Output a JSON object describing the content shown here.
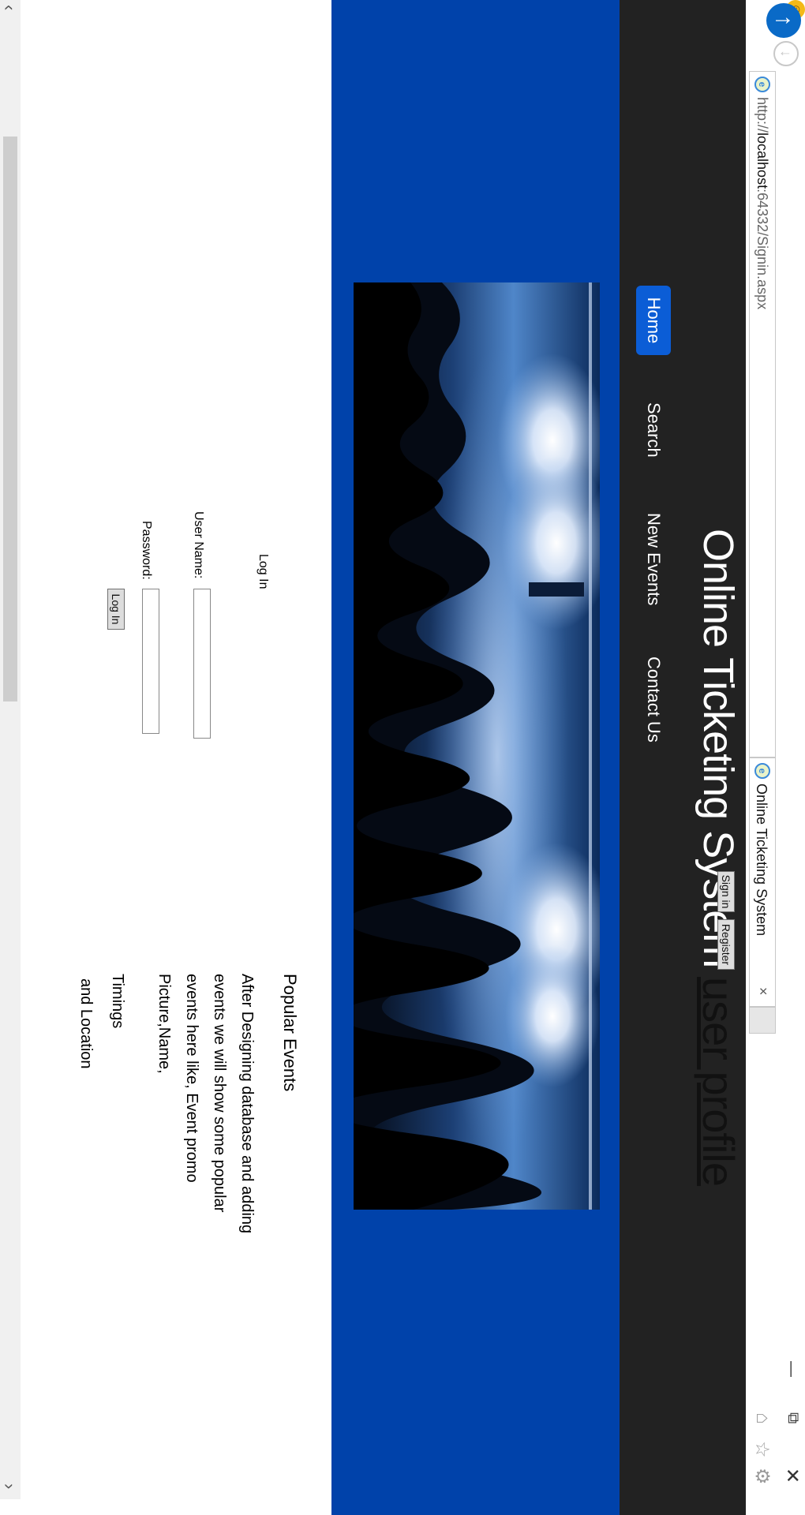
{
  "browser": {
    "url_prefix": "http://",
    "url_host": "localhost",
    "url_rest": ":64332/Signin.aspx",
    "tab_title": "Online Ticketing System",
    "tab_close": "×",
    "back_icon": "arrow-up",
    "forward_icon": "arrow-down"
  },
  "header": {
    "title": "Online Ticketing System",
    "signin_label": "Sign in",
    "register_label": "Register",
    "user_profile": "user profile"
  },
  "nav": {
    "items": [
      {
        "label": "Home",
        "active": true
      },
      {
        "label": "Search"
      },
      {
        "label": "New Events"
      },
      {
        "label": "Contact Us"
      }
    ]
  },
  "colors": {
    "header_bg": "#222222",
    "banner_bg": "#0042aa",
    "nav_active": "#0b5dd6"
  },
  "login": {
    "title": "Log In",
    "username_label": "User Name:",
    "username_value": "",
    "password_label": "Password:",
    "password_value": "",
    "button_label": "Log In"
  },
  "popular": {
    "title": "Popular Events",
    "lines": [
      "After Designing database and adding",
      "events we will show some popular",
      "events here like, Event promo",
      "Picture,Name,"
    ],
    "timings": "Timings",
    "location": "and Location"
  }
}
